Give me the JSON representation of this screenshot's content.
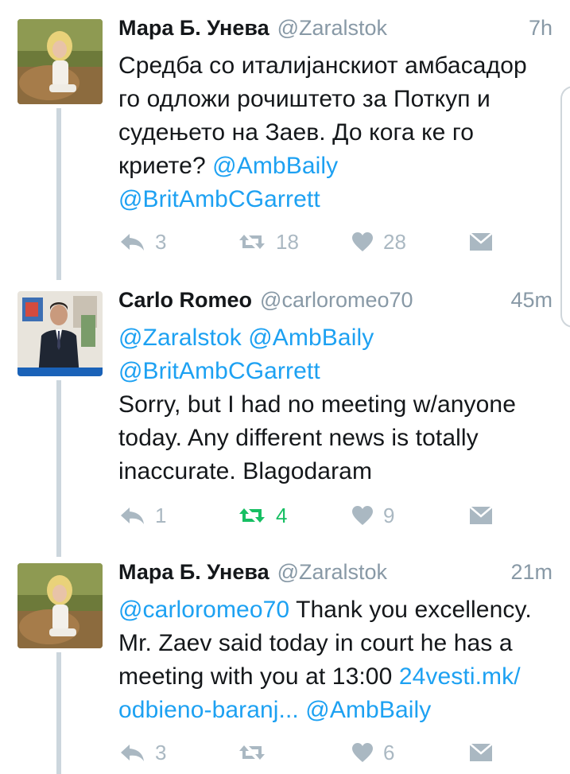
{
  "tweets": [
    {
      "display_name": "Мара Б. Унева",
      "handle": "@Zaralstok",
      "time": "7h",
      "lines": [
        [
          {
            "text": "Средба со италијанскиот амбасадор",
            "link": false
          }
        ],
        [
          {
            "text": "го одложи рочиштето за Поткуп и",
            "link": false
          }
        ],
        [
          {
            "text": "судењето на Заев. До кога ке го",
            "link": false
          }
        ],
        [
          {
            "text": "криете? ",
            "link": false
          },
          {
            "text": "@AmbBaily",
            "link": true
          }
        ],
        [
          {
            "text": "@BritAmbCGarrett",
            "link": true
          }
        ]
      ],
      "replies": "3",
      "retweets": "18",
      "likes": "28",
      "retweeted": false
    },
    {
      "display_name": "Carlo Romeo",
      "handle": "@carloromeo70",
      "time": "45m",
      "lines": [
        [
          {
            "text": "@Zaralstok @AmbBaily",
            "link": true
          }
        ],
        [
          {
            "text": "@BritAmbCGarrett",
            "link": true
          }
        ],
        [
          {
            "text": "Sorry, but I had no meeting w/anyone",
            "link": false
          }
        ],
        [
          {
            "text": "today. Any different news is totally",
            "link": false
          }
        ],
        [
          {
            "text": "inaccurate. Blagodaram",
            "link": false
          }
        ]
      ],
      "replies": "1",
      "retweets": "4",
      "likes": "9",
      "retweeted": true
    },
    {
      "display_name": "Мара Б. Унева",
      "handle": "@Zaralstok",
      "time": "21m",
      "lines": [
        [
          {
            "text": "@carloromeo70",
            "link": true
          },
          {
            "text": " Thank you excellency.",
            "link": false
          }
        ],
        [
          {
            "text": "Mr. Zaev said today in court he has a",
            "link": false
          }
        ],
        [
          {
            "text": "meeting with you at 13:00 ",
            "link": false
          },
          {
            "text": "24vesti.mk/",
            "link": true
          }
        ],
        [
          {
            "text": "odbieno-baranj... ",
            "link": true
          },
          {
            "text": "@AmbBaily",
            "link": true
          }
        ]
      ],
      "replies": "3",
      "retweets": "",
      "likes": "6",
      "retweeted": false
    }
  ],
  "colors": {
    "text": "#14171a",
    "secondary": "#8899a6",
    "link": "#1da1f2",
    "action_gray": "#aab8c2",
    "retweet_green": "#17bf63",
    "thread_line": "#ccd6dd"
  },
  "icons": {
    "reply": "reply-icon",
    "retweet": "retweet-icon",
    "like": "heart-icon",
    "dm": "envelope-icon"
  }
}
